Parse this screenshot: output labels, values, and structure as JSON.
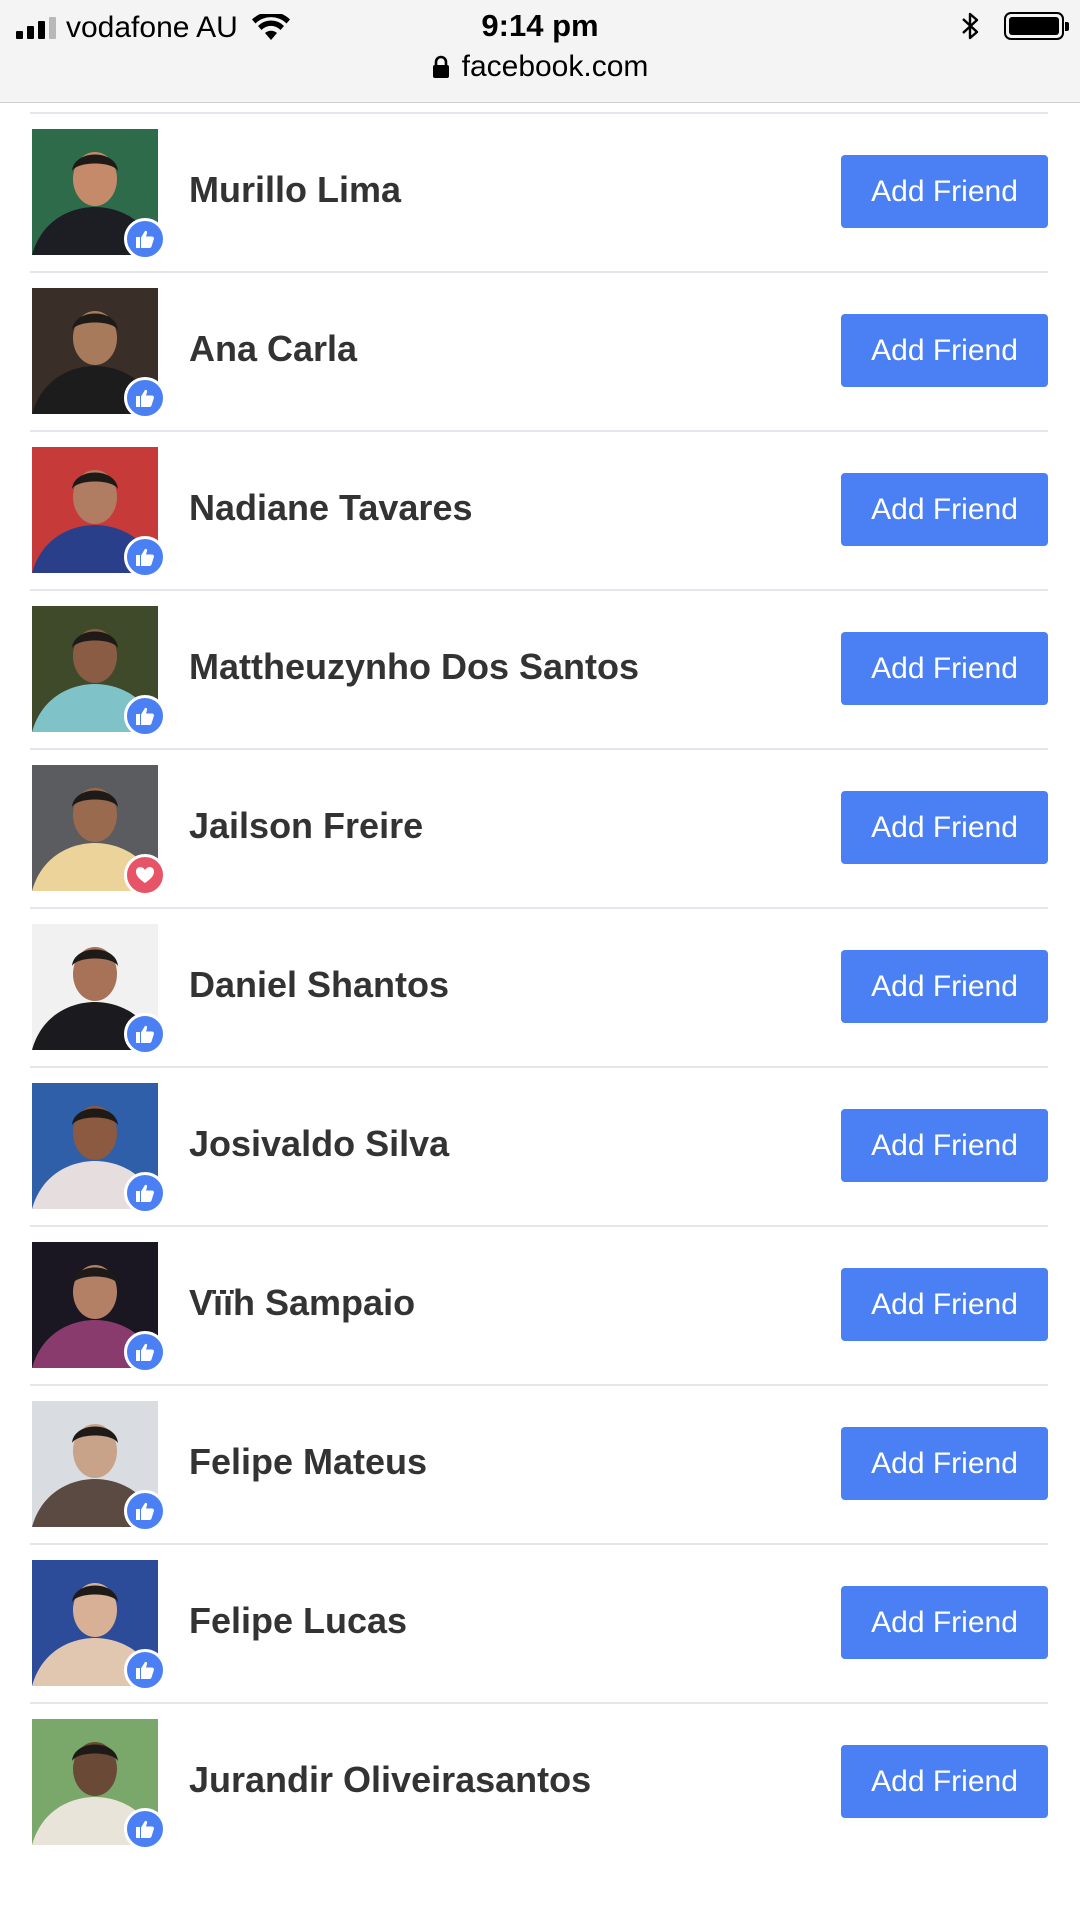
{
  "status_bar": {
    "carrier": "vodafone AU",
    "time": "9:14 pm",
    "signal_bars": 3,
    "battery_level": 1.0
  },
  "browser": {
    "url": "facebook.com"
  },
  "colors": {
    "accent": "#4a80f3",
    "like": "#4a80f3",
    "love": "#e85467",
    "name_text": "#333333",
    "divider": "#e4e6eb"
  },
  "people": [
    {
      "name": "Murillo Lima",
      "reaction": "like",
      "button": "Add Friend",
      "photo_colors": [
        "#2e6b4a",
        "#1d1d24",
        "#c48a6a"
      ]
    },
    {
      "name": "Ana Carla",
      "reaction": "like",
      "button": "Add Friend",
      "photo_colors": [
        "#3a2f28",
        "#1c1c1c",
        "#a87a5c"
      ]
    },
    {
      "name": "Nadiane Tavares",
      "reaction": "like",
      "button": "Add Friend",
      "photo_colors": [
        "#c73a3a",
        "#2a3f8a",
        "#b07c62"
      ]
    },
    {
      "name": "Mattheuzynho Dos Santos",
      "reaction": "like",
      "button": "Add Friend",
      "photo_colors": [
        "#3f4a2b",
        "#7fc3c9",
        "#8a5c44"
      ]
    },
    {
      "name": "Jailson Freire",
      "reaction": "love",
      "button": "Add Friend",
      "photo_colors": [
        "#5a5c60",
        "#ecd39a",
        "#9a6a4e"
      ]
    },
    {
      "name": "Daniel Shantos",
      "reaction": "like",
      "button": "Add Friend",
      "photo_colors": [
        "#f1f1f1",
        "#1b1b1f",
        "#a87258"
      ]
    },
    {
      "name": "Josivaldo Silva",
      "reaction": "like",
      "button": "Add Friend",
      "photo_colors": [
        "#2f5fa8",
        "#e6dede",
        "#8b5a40"
      ]
    },
    {
      "name": "Vïïh Sampaio",
      "reaction": "like",
      "button": "Add Friend",
      "photo_colors": [
        "#1a1622",
        "#8a3b6e",
        "#b38066"
      ]
    },
    {
      "name": "Felipe Mateus",
      "reaction": "like",
      "button": "Add Friend",
      "photo_colors": [
        "#d9dde2",
        "#5a4a42",
        "#c9a28a"
      ]
    },
    {
      "name": "Felipe Lucas",
      "reaction": "like",
      "button": "Add Friend",
      "photo_colors": [
        "#2c4c9a",
        "#e2c7b0",
        "#d8b096"
      ]
    },
    {
      "name": "Jurandir Oliveirasantos",
      "reaction": "like",
      "button": "Add Friend",
      "photo_colors": [
        "#7aa86a",
        "#e9e4da",
        "#6a4a36"
      ]
    }
  ]
}
